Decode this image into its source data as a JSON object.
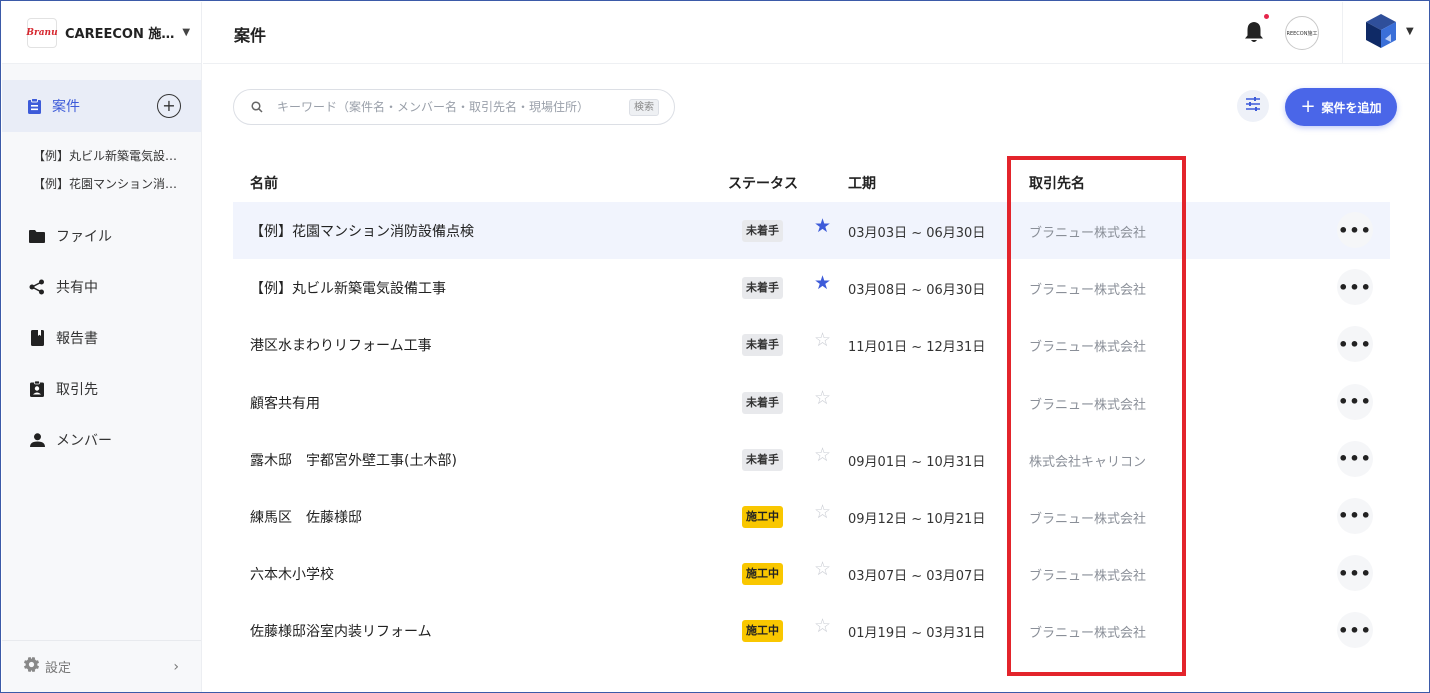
{
  "workspace": {
    "name": "CAREECON 施…",
    "logo_text": "Branu"
  },
  "sidebar": {
    "active": {
      "label": "案件",
      "icon": "clipboard-icon"
    },
    "projects": [
      "【例】丸ビル新築電気設…",
      "【例】花園マンション消…"
    ],
    "items": [
      {
        "label": "ファイル",
        "icon": "folder-icon"
      },
      {
        "label": "共有中",
        "icon": "share-icon"
      },
      {
        "label": "報告書",
        "icon": "book-icon"
      },
      {
        "label": "取引先",
        "icon": "contact-badge-icon"
      },
      {
        "label": "メンバー",
        "icon": "person-icon"
      }
    ],
    "settings_label": "設定"
  },
  "header": {
    "title": "案件",
    "org_avatar_text": "REECON施工"
  },
  "search": {
    "placeholder": "キーワード（案件名・メンバー名・取引先名・現場住所）",
    "key_label": "検索"
  },
  "add_button_label": "案件を追加",
  "table": {
    "headers": {
      "name": "名前",
      "status": "ステータス",
      "period": "工期",
      "client": "取引先名"
    },
    "rows": [
      {
        "name": "【例】花園マンション消防設備点検",
        "status": "未着手",
        "status_type": "todo",
        "starred": true,
        "period": "03月03日 ~ 06月30日",
        "client": "ブラニュー株式会社"
      },
      {
        "name": "【例】丸ビル新築電気設備工事",
        "status": "未着手",
        "status_type": "todo",
        "starred": true,
        "period": "03月08日 ~ 06月30日",
        "client": "ブラニュー株式会社"
      },
      {
        "name": "港区水まわりリフォーム工事",
        "status": "未着手",
        "status_type": "todo",
        "starred": false,
        "period": "11月01日 ~ 12月31日",
        "client": "ブラニュー株式会社"
      },
      {
        "name": "顧客共有用",
        "status": "未着手",
        "status_type": "todo",
        "starred": false,
        "period": "",
        "client": "ブラニュー株式会社"
      },
      {
        "name": "露木邸　宇都宮外壁工事(土木部)",
        "status": "未着手",
        "status_type": "todo",
        "starred": false,
        "period": "09月01日 ~ 10月31日",
        "client": "株式会社キャリコン"
      },
      {
        "name": "練馬区　佐藤様邸",
        "status": "施工中",
        "status_type": "doing",
        "starred": false,
        "period": "09月12日 ~ 10月21日",
        "client": "ブラニュー株式会社"
      },
      {
        "name": "六本木小学校",
        "status": "施工中",
        "status_type": "doing",
        "starred": false,
        "period": "03月07日 ~ 03月07日",
        "client": "ブラニュー株式会社"
      },
      {
        "name": "佐藤様邸浴室内装リフォーム",
        "status": "施工中",
        "status_type": "doing",
        "starred": false,
        "period": "01月19日 ~ 03月31日",
        "client": "ブラニュー株式会社"
      }
    ]
  },
  "colors": {
    "accent": "#3d5bd9",
    "primary_button": "#4a66e8",
    "status_doing": "#f9c700",
    "highlight": "#e3242b"
  }
}
